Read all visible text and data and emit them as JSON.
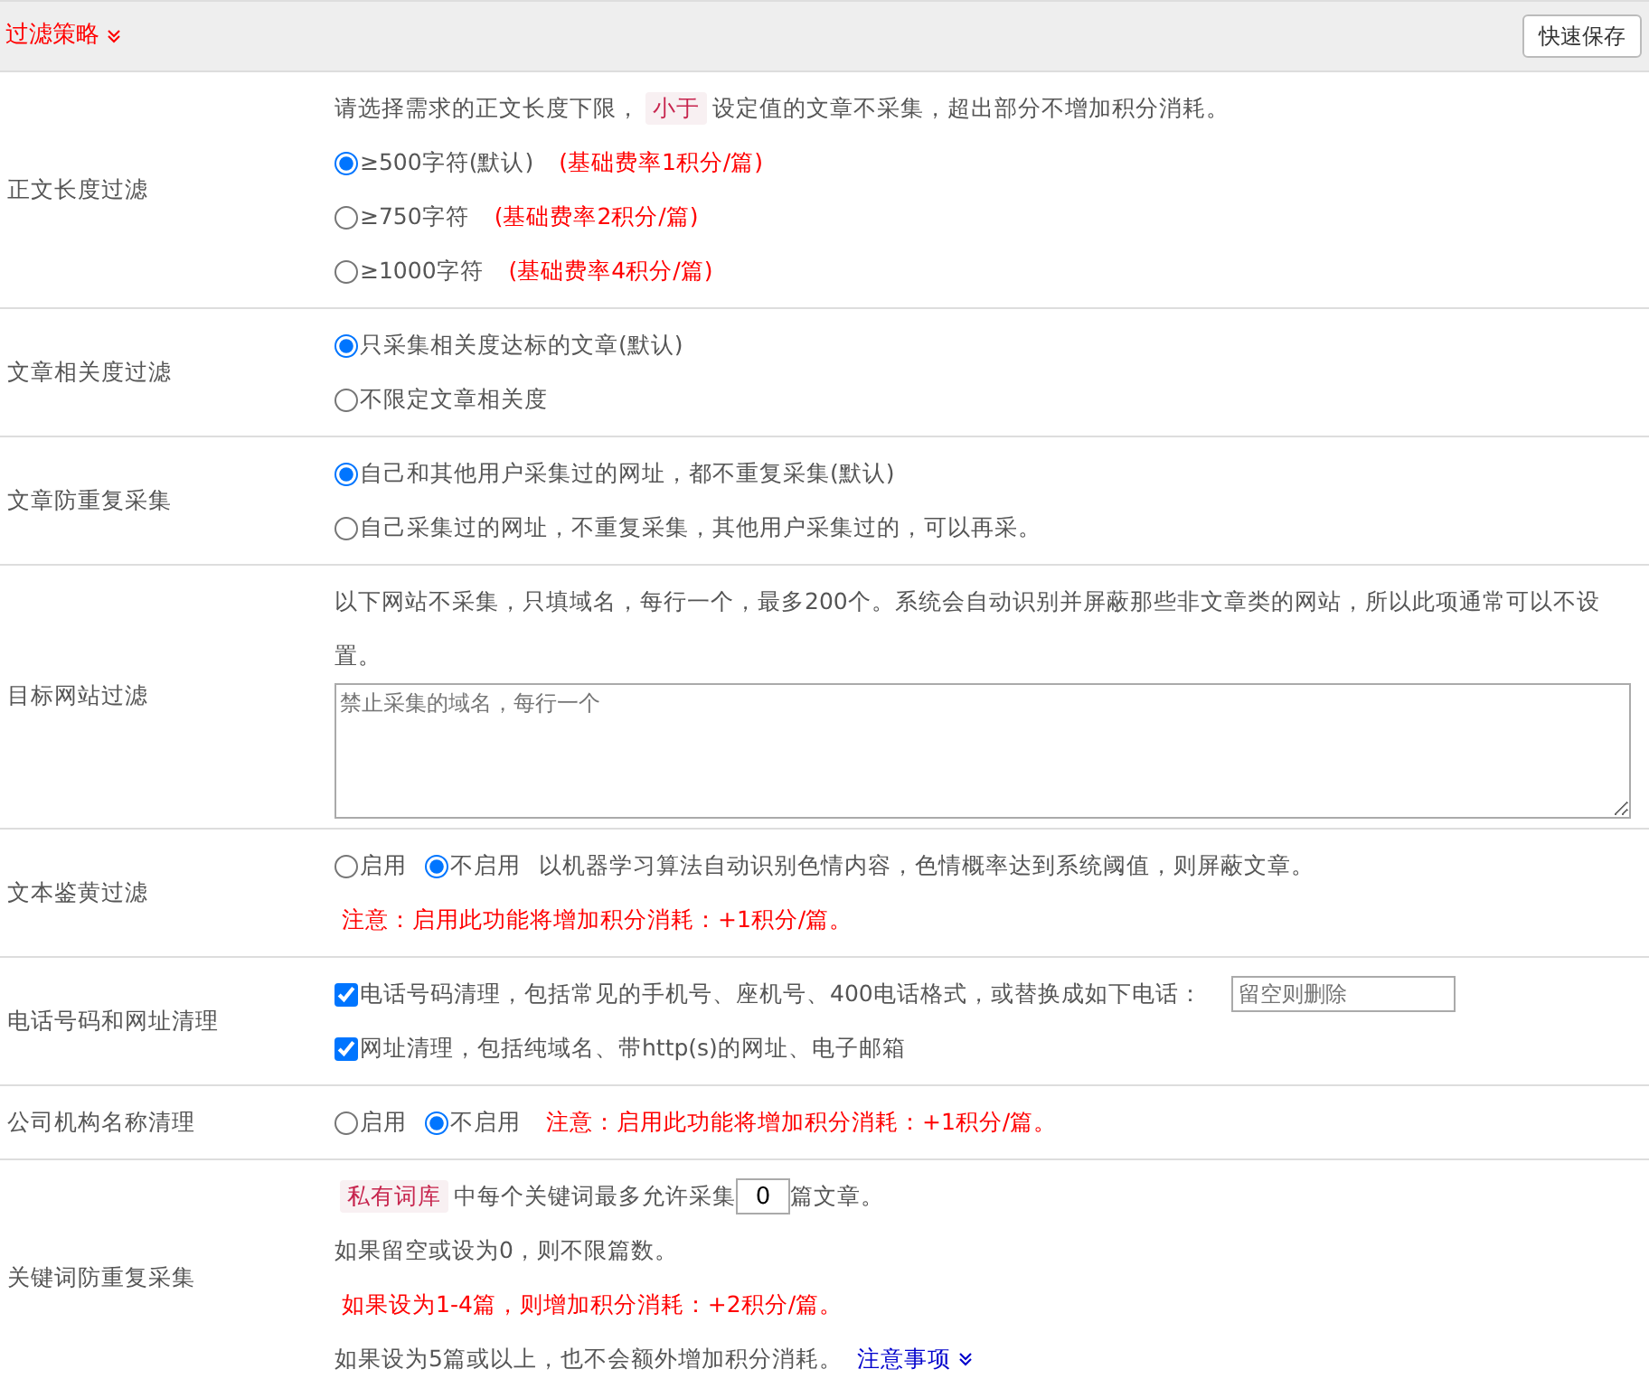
{
  "header": {
    "title": "过滤策略",
    "save_button": "快速保存"
  },
  "rows": [
    {
      "label": "正文长度过滤",
      "lines": [
        [
          {
            "kind": "text",
            "text": "请选择需求的正文长度下限，"
          },
          {
            "kind": "tag",
            "text": "小于"
          },
          {
            "kind": "text",
            "text": "设定值的文章不采集，超出部分不增加积分消耗。"
          }
        ],
        [
          {
            "kind": "radio",
            "label": "≥500字符(默认)",
            "selected": true
          },
          {
            "kind": "warn",
            "text": "(基础费率1积分/篇)"
          }
        ],
        [
          {
            "kind": "radio",
            "label": "≥750字符",
            "selected": false
          },
          {
            "kind": "warn",
            "text": "(基础费率2积分/篇)"
          }
        ],
        [
          {
            "kind": "radio",
            "label": "≥1000字符",
            "selected": false
          },
          {
            "kind": "warn",
            "text": "(基础费率4积分/篇)"
          }
        ]
      ]
    },
    {
      "label": "文章相关度过滤",
      "lines": [
        [
          {
            "kind": "radio",
            "label": "只采集相关度达标的文章(默认)",
            "selected": true
          }
        ],
        [
          {
            "kind": "radio",
            "label": "不限定文章相关度",
            "selected": false
          }
        ]
      ]
    },
    {
      "label": "文章防重复采集",
      "lines": [
        [
          {
            "kind": "radio",
            "label": "自己和其他用户采集过的网址，都不重复采集(默认)",
            "selected": true
          }
        ],
        [
          {
            "kind": "radio",
            "label": "自己采集过的网址，不重复采集，其他用户采集过的，可以再采。",
            "selected": false
          }
        ]
      ]
    },
    {
      "label": "目标网站过滤",
      "lines": [
        [
          {
            "kind": "text",
            "text": "以下网站不采集，只填域名，每行一个，最多200个。系统会自动识别并屏蔽那些非文章类的网站，所以此项通常可以不设置。"
          }
        ],
        [
          {
            "kind": "textarea",
            "placeholder": "禁止采集的域名，每行一个"
          }
        ]
      ]
    },
    {
      "label": "文本鉴黄过滤",
      "lines": [
        [
          {
            "kind": "radio",
            "label": "启用",
            "selected": false
          },
          {
            "kind": "radio",
            "label": "不启用",
            "selected": true
          },
          {
            "kind": "text",
            "text": "以机器学习算法自动识别色情内容，色情概率达到系统阈值，则屏蔽文章。"
          }
        ],
        [
          {
            "kind": "warn",
            "text": "注意：启用此功能将增加积分消耗：+1积分/篇。"
          }
        ]
      ]
    },
    {
      "label": "电话号码和网址清理",
      "lines": [
        [
          {
            "kind": "checkbox",
            "label": "电话号码清理，包括常见的手机号、座机号、400电话格式，或替换成如下电话：",
            "checked": true
          },
          {
            "kind": "input",
            "placeholder": "留空则删除"
          }
        ],
        [
          {
            "kind": "checkbox",
            "label": "网址清理，包括纯域名、带http(s)的网址、电子邮箱",
            "checked": true
          }
        ]
      ]
    },
    {
      "label": "公司机构名称清理",
      "lines": [
        [
          {
            "kind": "radio",
            "label": "启用",
            "selected": false
          },
          {
            "kind": "radio",
            "label": "不启用",
            "selected": true
          },
          {
            "kind": "warn",
            "text": "注意：启用此功能将增加积分消耗：+1积分/篇。"
          }
        ]
      ]
    },
    {
      "label": "关键词防重复采集",
      "lines": [
        [
          {
            "kind": "tag",
            "text": "私有词库"
          },
          {
            "kind": "text",
            "text": "中每个关键词最多允许采集"
          },
          {
            "kind": "num",
            "value": "0"
          },
          {
            "kind": "text",
            "text": "篇文章。"
          }
        ],
        [
          {
            "kind": "text",
            "text": "如果留空或设为0，则不限篇数。"
          }
        ],
        [
          {
            "kind": "warn",
            "text": "如果设为1-4篇，则增加积分消耗：+2积分/篇。"
          }
        ],
        [
          {
            "kind": "text",
            "text": "如果设为5篇或以上，也不会额外增加积分消耗。"
          },
          {
            "kind": "link",
            "text": "注意事项"
          }
        ]
      ]
    }
  ]
}
